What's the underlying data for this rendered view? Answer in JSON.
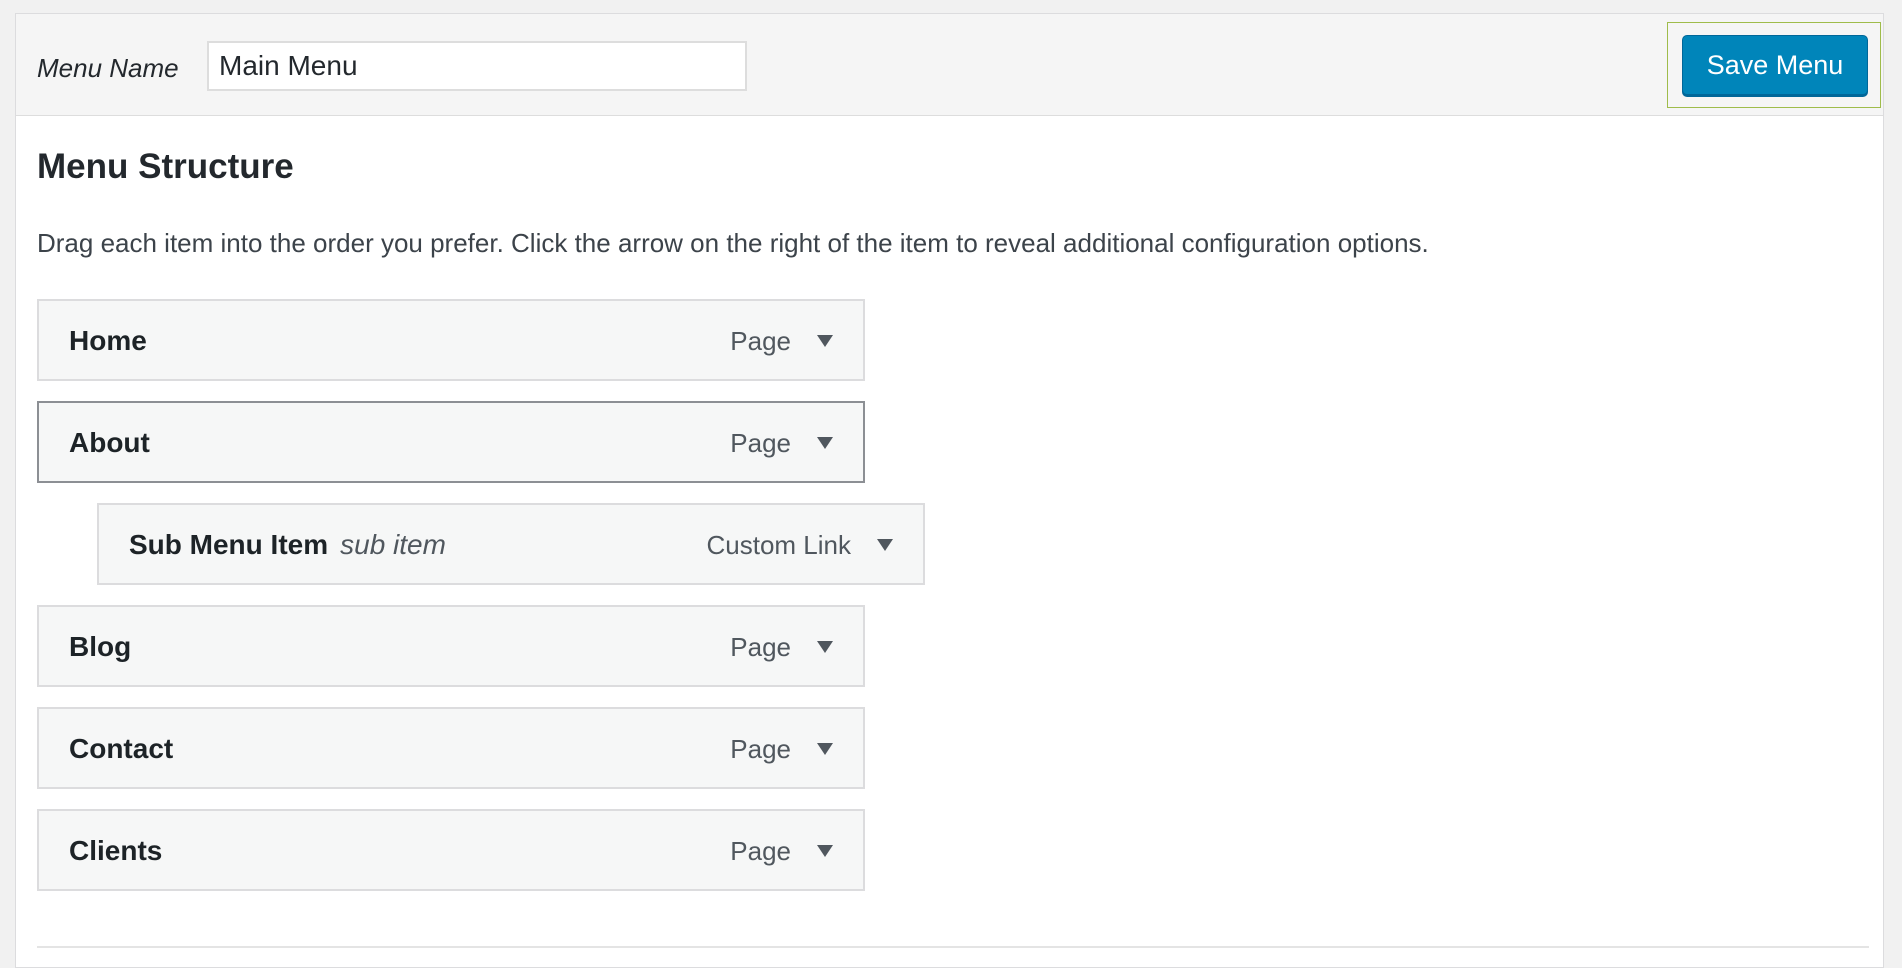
{
  "header": {
    "menu_name_label": "Menu Name",
    "menu_name_value": "Main Menu",
    "save_label": "Save Menu"
  },
  "structure": {
    "title": "Menu Structure",
    "instructions": "Drag each item into the order you prefer. Click the arrow on the right of the item to reveal additional configuration options."
  },
  "items": [
    {
      "title": "Home",
      "type": "Page"
    },
    {
      "title": "About",
      "type": "Page"
    },
    {
      "title": "Sub Menu Item",
      "sub_label": "sub item",
      "type": "Custom Link"
    },
    {
      "title": "Blog",
      "type": "Page"
    },
    {
      "title": "Contact",
      "type": "Page"
    },
    {
      "title": "Clients",
      "type": "Page"
    }
  ],
  "icons": {
    "expand": "triangle-down-icon"
  },
  "colors": {
    "primary_button": "#0085ba",
    "text": "#23282d"
  }
}
